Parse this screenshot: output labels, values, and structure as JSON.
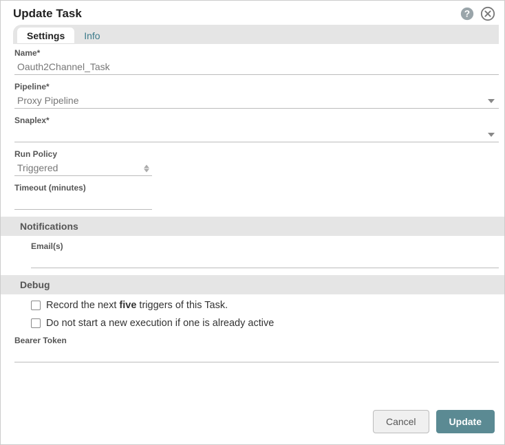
{
  "dialog": {
    "title": "Update Task"
  },
  "tabs": {
    "settings": "Settings",
    "info": "Info"
  },
  "fields": {
    "name_label": "Name*",
    "name_value": "Oauth2Channel_Task",
    "pipeline_label": "Pipeline*",
    "pipeline_value": "Proxy Pipeline",
    "snaplex_label": "Snaplex*",
    "snaplex_value": "",
    "runpolicy_label": "Run Policy",
    "runpolicy_value": "Triggered",
    "timeout_label": "Timeout (minutes)",
    "timeout_value": ""
  },
  "sections": {
    "notifications": "Notifications",
    "debug": "Debug"
  },
  "notifications": {
    "emails_label": "Email(s)",
    "emails_value": ""
  },
  "debug": {
    "record_prefix": "Record the next ",
    "record_bold": "five",
    "record_suffix": " triggers of this Task.",
    "nostart": "Do not start a new execution if one is already active"
  },
  "bearer": {
    "label": "Bearer Token",
    "value": ""
  },
  "footer": {
    "cancel": "Cancel",
    "update": "Update"
  }
}
